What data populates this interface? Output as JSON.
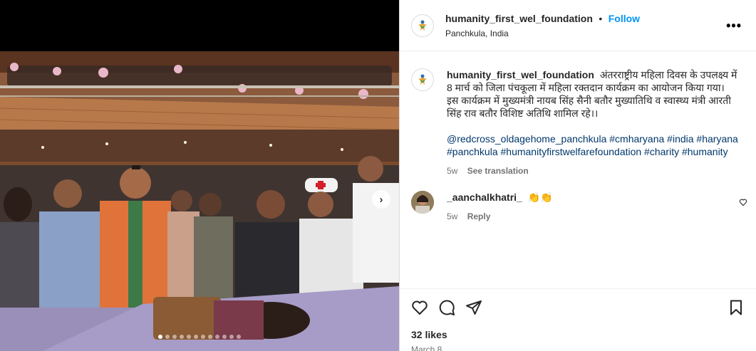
{
  "post": {
    "username": "humanity_first_wel_foundation",
    "separator": "•",
    "follow_label": "Follow",
    "location": "Panchkula, India",
    "more_label": "•••",
    "caption": "अंतरराष्ट्रीय महिला दिवस के उपलक्ष्य में 8 मार्च को जिला पंचकूला में महिला रक्तदान कार्यक्रम का आयोजन किया गया। इस कार्यक्रम में मुख्यमंत्री नायब सिंह सैनी बतौर मुख्यातिथि व स्वास्थ्य मंत्री आरती सिंह राव बतौर विशिष्ट अतिथि शामिल रहे।।",
    "hashtags": "@redcross_oldagehome_panchkula #cmharyana #india #haryana #panchkula #humanityfirstwelfarefoundation #charity #humanity",
    "caption_age": "5w",
    "see_translation": "See translation",
    "likes": "32 likes",
    "date": "March 8"
  },
  "comment": {
    "username": "_aanchalkhatri_",
    "text": "👏👏",
    "age": "5w",
    "reply": "Reply"
  },
  "carousel": {
    "count": 12,
    "active_index": 0,
    "next_icon": "chevron-right-icon"
  },
  "icons": [
    "heart-icon",
    "comment-icon",
    "share-icon",
    "bookmark-icon",
    "more-icon"
  ],
  "colors": {
    "accent": "#0095f6",
    "hashtag": "#00376b",
    "muted": "#737373"
  }
}
